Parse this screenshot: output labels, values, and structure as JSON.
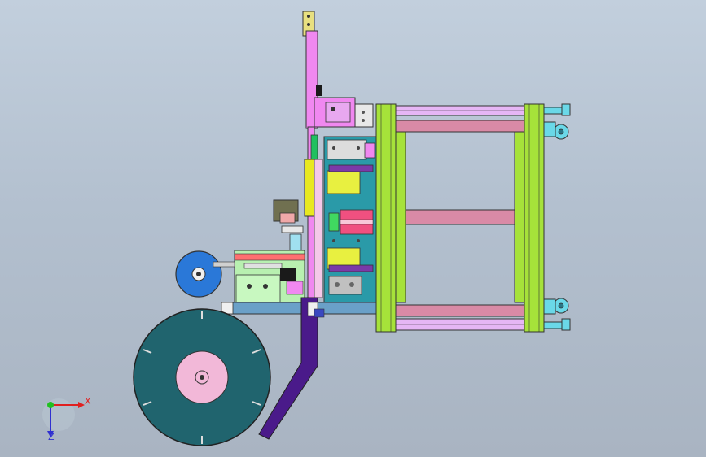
{
  "viewport": {
    "background_top": "#c2cfdd",
    "background_bottom": "#a9b4c2"
  },
  "triad": {
    "x_label": "X",
    "z_label": "Z",
    "x_color": "#e02020",
    "y_color": "#20c020",
    "z_color": "#3030d0"
  },
  "colors": {
    "frame_green": "#a6e23a",
    "frame_pink": "#d98aa6",
    "frame_violet": "#e0a8f0",
    "plate_teal": "#2a9aa8",
    "arm_magenta": "#f088f0",
    "chute_purple": "#4a1a8a",
    "reel_teal": "#20646e",
    "reel_hub_pink": "#f2b8d8",
    "small_reel_blue": "#2a78d8",
    "foot_cyan": "#6ad8e8",
    "yellow_part": "#e8e820",
    "light_green_box": "#b8f0b0"
  }
}
